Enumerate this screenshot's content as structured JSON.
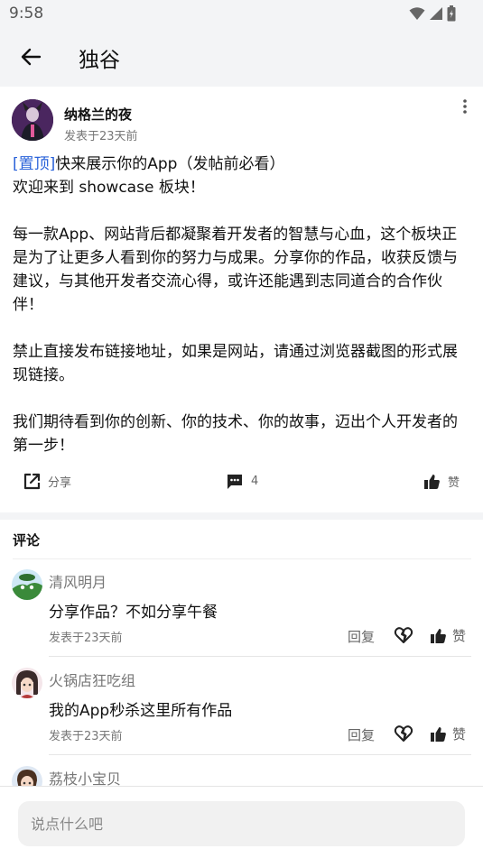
{
  "status_bar": {
    "time": "9:58",
    "icons": [
      "wifi-icon",
      "signal-icon",
      "battery-icon"
    ]
  },
  "app_bar": {
    "back_icon": "arrow-left-icon",
    "title": "独谷"
  },
  "post": {
    "author": {
      "name": "纳格兰的夜",
      "time": "发表于23天前",
      "avatar_icon": "avatar"
    },
    "more_icon": "more-vertical-icon",
    "pin_tag": "[置顶]",
    "title": "快来展示你的App（发帖前必看）",
    "paragraphs": [
      "欢迎来到 showcase 板块！",
      "每一款App、网站背后都凝聚着开发者的智慧与心血，这个板块正是为了让更多人看到你的努力与成果。分享你的作品，收获反馈与建议，与其他开发者交流心得，或许还能遇到志同道合的合作伙伴！",
      "禁止直接发布链接地址，如果是网站，请通过浏览器截图的形式展现链接。",
      "我们期待看到你的创新、你的技术、你的故事，迈出个人开发者的第一步！"
    ],
    "actions": {
      "share_label": "分享",
      "comment_count": "4",
      "like_label": "赞"
    }
  },
  "comments_section": {
    "header": "评论",
    "items": [
      {
        "name": "清风明月",
        "text": "分享作品？不如分享午餐",
        "time": "发表于23天前",
        "reply_label": "回复",
        "like_label": "赞"
      },
      {
        "name": "火锅店狂吃组",
        "text": "我的App秒杀这里所有作品",
        "time": "发表于23天前",
        "reply_label": "回复",
        "like_label": "赞"
      },
      {
        "name": "荔枝小宝贝"
      }
    ]
  },
  "bottom_bar": {
    "placeholder": "说点什么吧"
  },
  "colors": {
    "accent": "#2962d9",
    "bar_background": "#f3f4f6",
    "secondary_text": "#777777"
  }
}
